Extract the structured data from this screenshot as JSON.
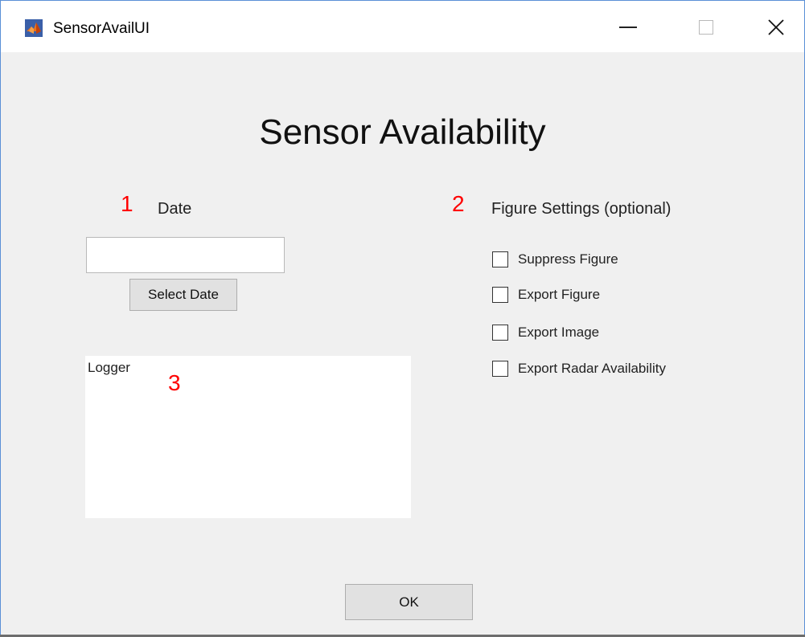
{
  "window": {
    "title": "SensorAvailUI",
    "icon": "matlab-icon",
    "controls": {
      "minimize": "minimize-icon",
      "maximize": "maximize-icon",
      "close": "✕"
    }
  },
  "heading": "Sensor Availability",
  "markers": {
    "one": "1",
    "two": "2",
    "three": "3"
  },
  "colors": {
    "marker": "#ff0000",
    "background": "#f0f0f0",
    "button": "#e1e1e1"
  },
  "date_section": {
    "label": "Date",
    "input_value": "",
    "select_button": "Select Date"
  },
  "figure_settings": {
    "label": "Figure Settings (optional)",
    "options": [
      {
        "label": "Suppress Figure",
        "checked": false
      },
      {
        "label": "Export Figure",
        "checked": false
      },
      {
        "label": "Export Image",
        "checked": false
      },
      {
        "label": "Export Radar Availability",
        "checked": false
      }
    ]
  },
  "logger": {
    "text": "Logger"
  },
  "ok_button": "OK"
}
